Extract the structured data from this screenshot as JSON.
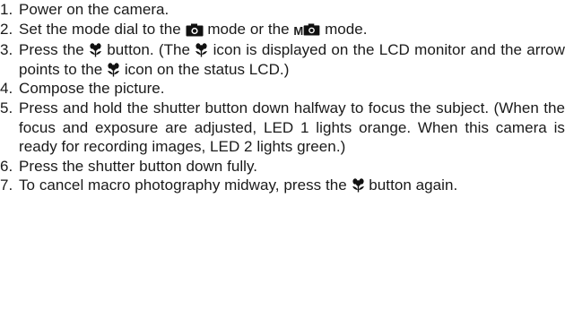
{
  "icons": {
    "camera": "camera-icon",
    "manual_camera": "manual-camera-icon",
    "macro": "macro-flower-icon"
  },
  "steps": [
    {
      "num": "1.",
      "text": "Power on the camera."
    },
    {
      "num": "2.",
      "a": "Set the mode dial to the",
      "b": "mode or the",
      "mark": "M",
      "c": "mode."
    },
    {
      "num": "3.",
      "a": "Press the",
      "b": "button. (The",
      "c": "icon is displayed on the LCD monitor and the arrow points to the",
      "d": "icon on the status LCD.)"
    },
    {
      "num": "4.",
      "text": "Compose the picture."
    },
    {
      "num": "5.",
      "text": "Press and hold the shutter button down halfway to focus the subject. (When the focus and exposure are adjusted, LED 1 lights orange. When this camera is ready for recording images, LED 2 lights green.)"
    },
    {
      "num": "6.",
      "text": "Press the shutter button down fully."
    },
    {
      "num": "7.",
      "a": "To cancel macro photography midway, press the",
      "b": "button again."
    }
  ]
}
